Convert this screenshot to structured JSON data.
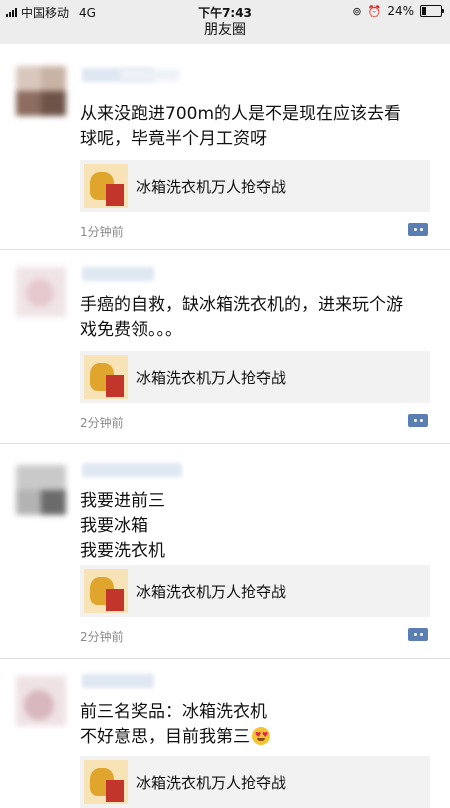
{
  "status": {
    "carrier": "中国移动",
    "network": "4G",
    "time": "下午7:43",
    "battery": "24%",
    "battery_level": 0.24
  },
  "page": {
    "title": "朋友圈"
  },
  "posts": [
    {
      "text": "从来没跑进700m的人是不是现在应该去看\n球呢，毕竟半个月工资呀",
      "link_title": "冰箱洗衣机万人抢夺战",
      "time": "1分钟前"
    },
    {
      "text": "手癌的自救，缺冰箱洗衣机的，进来玩个游\n戏免费领。。。",
      "link_title": "冰箱洗衣机万人抢夺战",
      "time": "2分钟前"
    },
    {
      "text": "我要进前三\n我要冰箱\n我要洗衣机",
      "link_title": "冰箱洗衣机万人抢夺战",
      "time": "2分钟前"
    },
    {
      "text": "前三名奖品：冰箱洗衣机\n不好意思，目前我第三",
      "emoji": "😍",
      "link_title": "冰箱洗衣机万人抢夺战"
    }
  ],
  "colors": {
    "bar": "#ededed",
    "card": "#f2f2f2",
    "comment_icon": "#5a7eb1",
    "time": "#8a8a8a"
  }
}
